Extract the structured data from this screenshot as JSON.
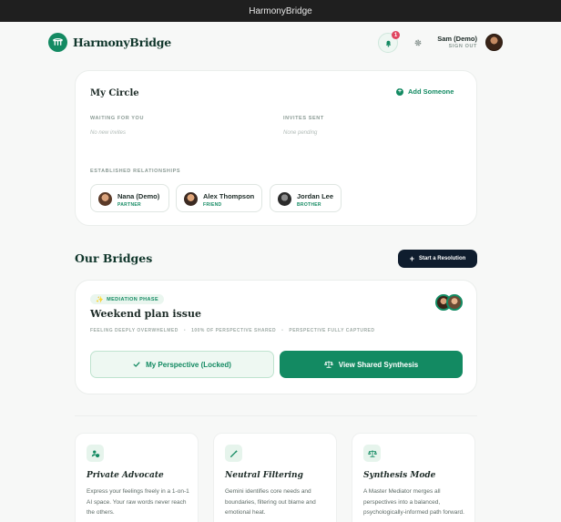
{
  "window": {
    "title": "HarmonyBridge"
  },
  "header": {
    "logo_text": "HarmonyBridge",
    "notification_count": "1",
    "user_name": "Sam (Demo)",
    "sign_out_label": "SIGN OUT"
  },
  "circle": {
    "title": "My Circle",
    "add_label": "Add Someone",
    "waiting_label": "WAITING FOR YOU",
    "waiting_empty": "No new invites",
    "sent_label": "INVITES SENT",
    "sent_empty": "None pending",
    "established_label": "ESTABLISHED RELATIONSHIPS",
    "relationships": [
      {
        "name": "Nana (Demo)",
        "role": "PARTNER"
      },
      {
        "name": "Alex Thompson",
        "role": "FRIEND"
      },
      {
        "name": "Jordan Lee",
        "role": "BROTHER"
      }
    ]
  },
  "bridges": {
    "title": "Our Bridges",
    "start_label": "Start a Resolution",
    "items": [
      {
        "phase": "MEDIATION PHASE",
        "title": "Weekend plan issue",
        "meta": [
          "FEELING DEEPLY OVERWHELMED",
          "100% OF PERSPECTIVE SHARED",
          "PERSPECTIVE FULLY CAPTURED"
        ],
        "perspective_label": "My Perspective (Locked)",
        "synthesis_label": "View Shared Synthesis"
      }
    ]
  },
  "features": [
    {
      "icon": "person-shield-icon",
      "title": "Private Advocate",
      "desc": "Express your feelings freely in a 1-on-1 AI space. Your raw words never reach the others."
    },
    {
      "icon": "magic-wand-icon",
      "title": "Neutral Filtering",
      "desc": "Gemini identifies core needs and boundaries, filtering out blame and emotional heat."
    },
    {
      "icon": "scales-icon",
      "title": "Synthesis Mode",
      "desc": "A Master Mediator merges all perspectives into a balanced, psychologically-informed path forward."
    }
  ],
  "colors": {
    "brand": "#138a62",
    "dark_button": "#0f1d2e",
    "badge_red": "#e0455f"
  }
}
